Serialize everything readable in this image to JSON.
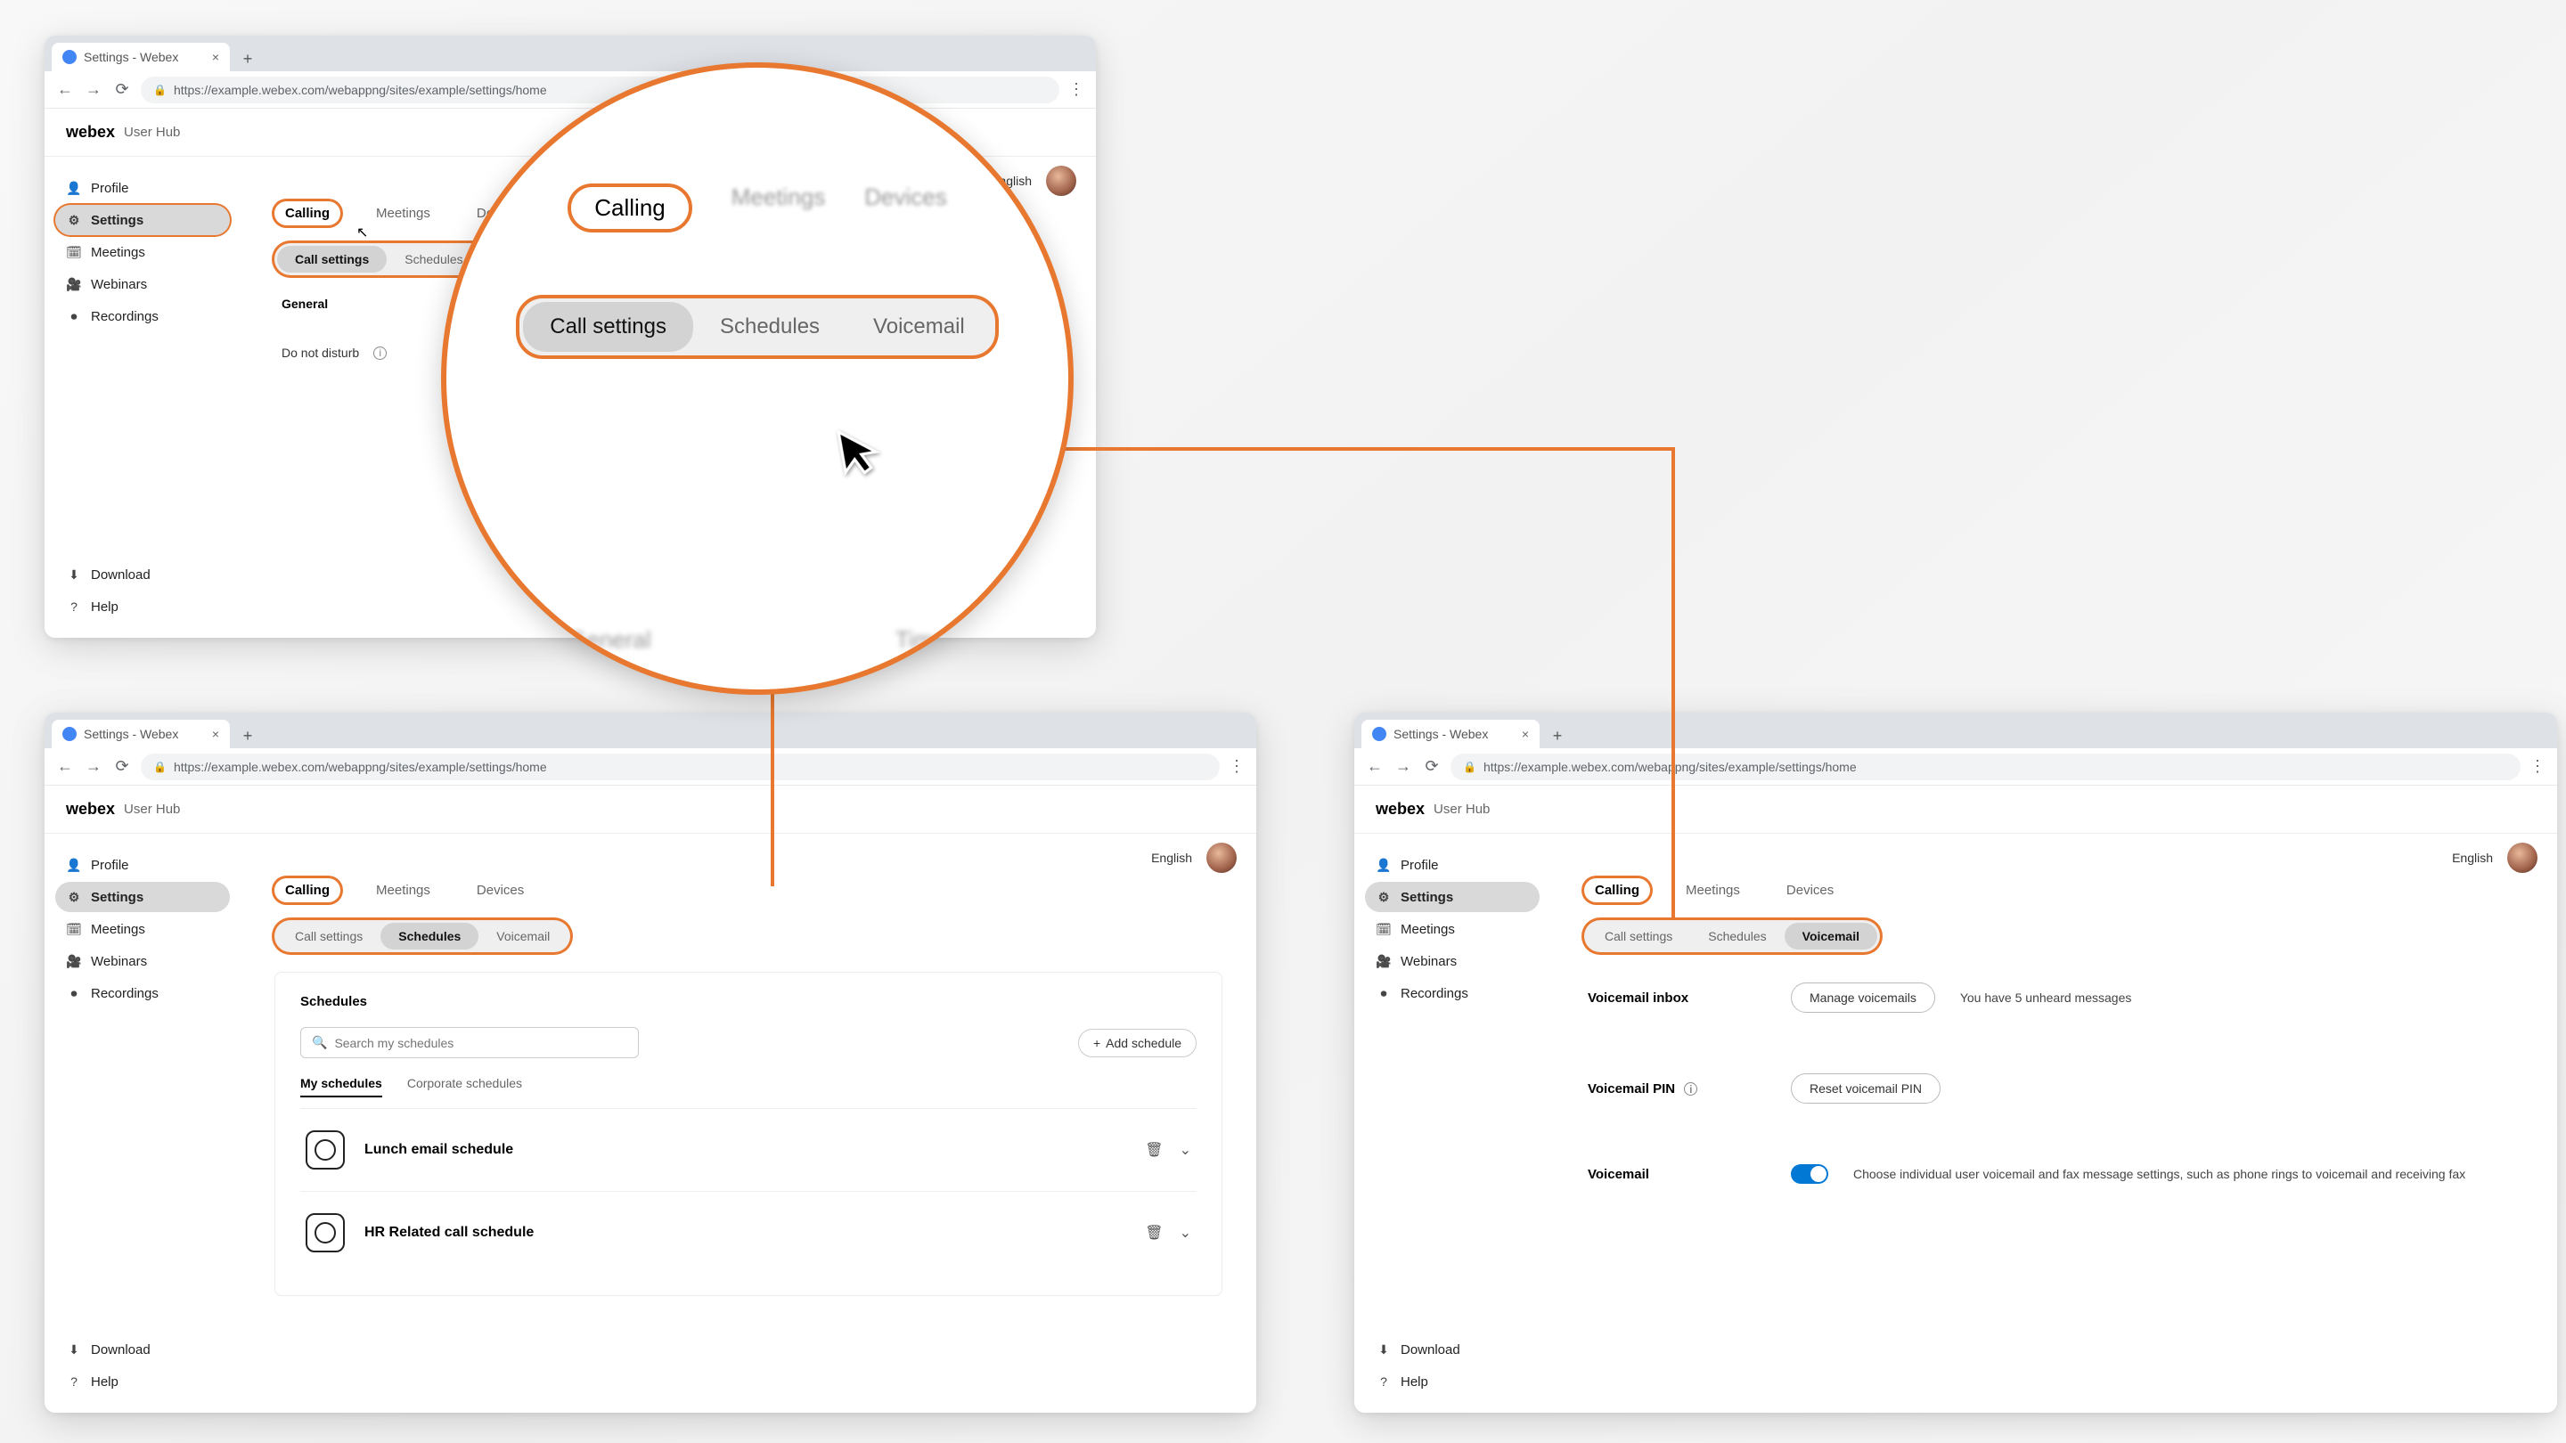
{
  "browser": {
    "tab_title": "Settings - Webex",
    "url": "https://example.webex.com/webappng/sites/example/settings/home"
  },
  "header": {
    "brand": "webex",
    "sub": "User Hub"
  },
  "sidebar": {
    "items": [
      {
        "icon": "person-icon",
        "label": "Profile"
      },
      {
        "icon": "gear-icon",
        "label": "Settings"
      },
      {
        "icon": "calendar-icon",
        "label": "Meetings"
      },
      {
        "icon": "webinars-icon",
        "label": "Webinars"
      },
      {
        "icon": "record-icon",
        "label": "Recordings"
      }
    ],
    "footer": [
      {
        "icon": "download-icon",
        "label": "Download"
      },
      {
        "icon": "help-icon",
        "label": "Help"
      }
    ]
  },
  "language": "English",
  "section_tabs": [
    "Calling",
    "Meetings",
    "Devices"
  ],
  "sub_tabs": [
    "Call settings",
    "Schedules",
    "Voicemail"
  ],
  "magnifier": {
    "tabs": [
      "Calling",
      "Meetings",
      "Devices"
    ],
    "subtabs": [
      "Call settings",
      "Schedules",
      "Voicemail"
    ],
    "bottom": [
      "General",
      "Time"
    ]
  },
  "win1": {
    "general_heading": "General",
    "dnd_label": "Do not disturb"
  },
  "win2": {
    "panel_title": "Schedules",
    "search_placeholder": "Search my schedules",
    "add_btn": "Add schedule",
    "subnav": [
      "My schedules",
      "Corporate schedules"
    ],
    "schedules": [
      "Lunch email schedule",
      "HR Related call schedule"
    ]
  },
  "win3": {
    "rows": [
      {
        "label": "Voicemail inbox",
        "button": "Manage voicemails",
        "desc": "You have 5 unheard messages"
      },
      {
        "label": "Voicemail PIN",
        "button": "Reset voicemail PIN",
        "desc": ""
      },
      {
        "label": "Voicemail",
        "toggle_desc": "Choose individual user voicemail and fax message settings, such as phone rings to voicemail and receiving fax"
      }
    ]
  }
}
